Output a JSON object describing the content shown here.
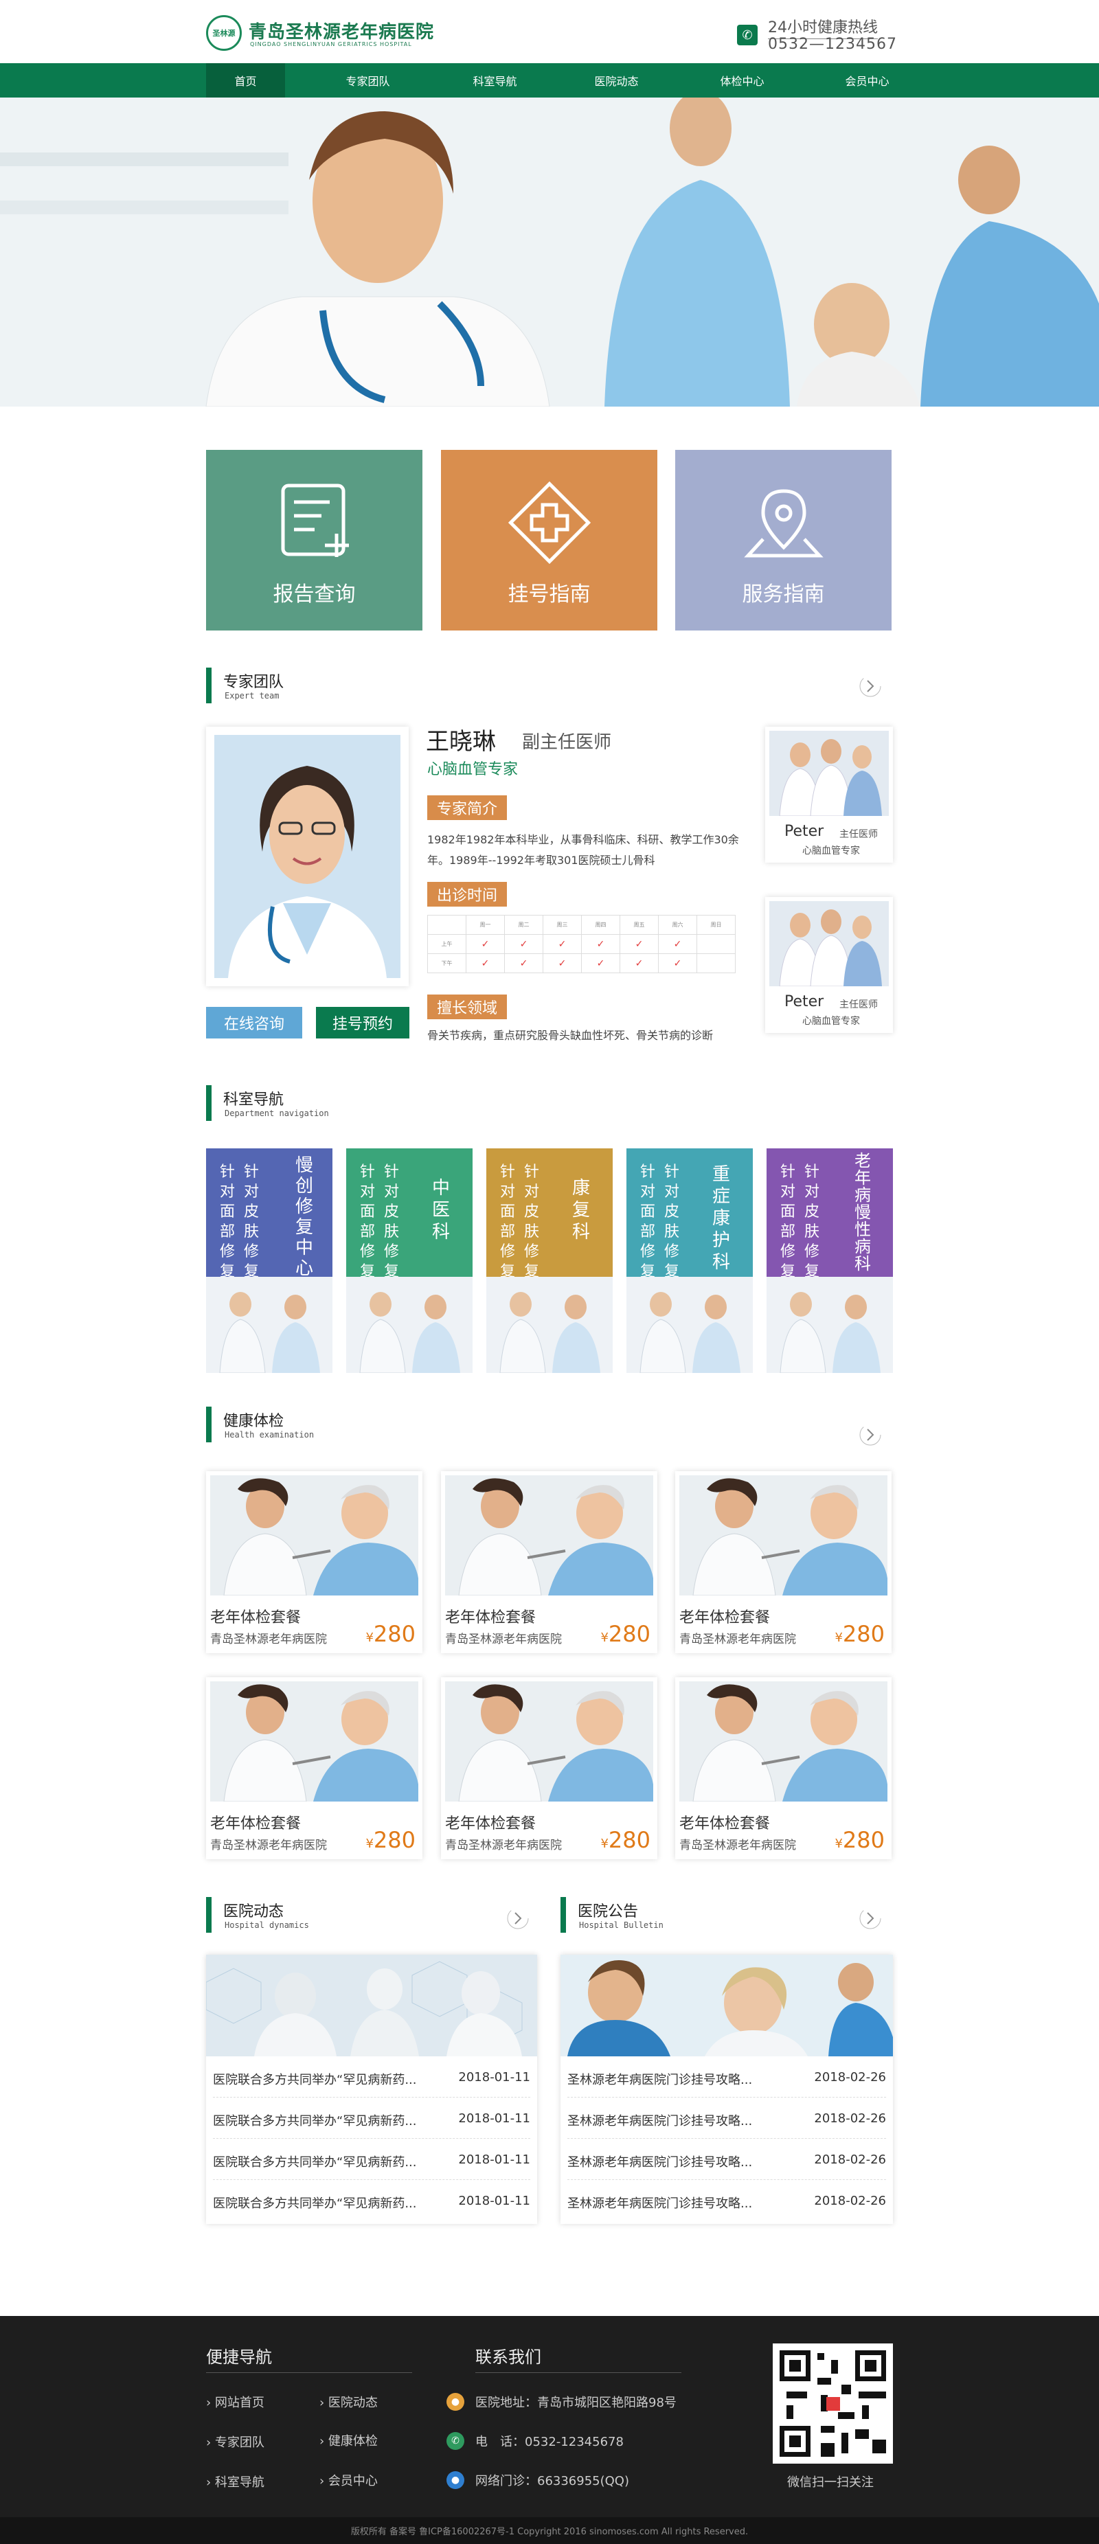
{
  "header": {
    "logo_mark": "圣林源",
    "title": "青岛圣林源老年病医院",
    "subtitle": "QINGDAO SHENGLINYUAN GERIATRICS HOSPITAL",
    "hotline_label": "24小时健康热线",
    "hotline_number": "0532—1234567"
  },
  "nav": {
    "items": [
      "首页",
      "专家团队",
      "科室导航",
      "医院动态",
      "体检中心",
      "会员中心"
    ],
    "active_index": 0
  },
  "quick": [
    {
      "label": "报告查询",
      "color": "#5a9c84",
      "icon": "report-icon"
    },
    {
      "label": "挂号指南",
      "color": "#d98e4e",
      "icon": "medical-cross-icon"
    },
    {
      "label": "服务指南",
      "color": "#a3adcf",
      "icon": "location-pin-icon"
    }
  ],
  "expert_section": {
    "title": "专家团队",
    "subtitle": "Expert team"
  },
  "expert": {
    "name": "王晓琳",
    "rank": "副主任医师",
    "specialty": "心脑血管专家",
    "intro_tag": "专家简介",
    "intro": "1982年1982年本科毕业，从事骨科临床、科研、教学工作30余年。1989年--1992年考取301医院硕士儿骨科",
    "schedule_tag": "出诊时间",
    "schedule_days": [
      "周一",
      "周二",
      "周三",
      "周四",
      "周五",
      "周六",
      "周日"
    ],
    "schedule_rows": [
      {
        "label": "上午",
        "marks": [
          "✓",
          "✓",
          "✓",
          "✓",
          "✓",
          "✓",
          ""
        ]
      },
      {
        "label": "下午",
        "marks": [
          "✓",
          "✓",
          "✓",
          "✓",
          "✓",
          "✓",
          ""
        ]
      }
    ],
    "field_tag": "擅长领域",
    "field": "骨关节疾病，重点研究股骨头缺血性坏死、骨关节病的诊断",
    "consult_btn": "在线咨询",
    "book_btn": "挂号预约"
  },
  "side_doctors": [
    {
      "name": "Peter",
      "rank": "主任医师",
      "specialty": "心脑血管专家"
    },
    {
      "name": "Peter",
      "rank": "主任医师",
      "specialty": "心脑血管专家"
    }
  ],
  "dept_section": {
    "title": "科室导航",
    "subtitle": "Department navigation"
  },
  "depts": [
    {
      "name": "慢创修复中心",
      "desc": [
        "针对面部修复",
        "针对皮肤修复"
      ],
      "color": "#5466b3"
    },
    {
      "name": "中医科",
      "desc": [
        "针对面部修复",
        "针对皮肤修复"
      ],
      "color": "#3aa57a"
    },
    {
      "name": "康复科",
      "desc": [
        "针对面部修复",
        "针对皮肤修复"
      ],
      "color": "#c99b3e"
    },
    {
      "name": "重症康护科",
      "desc": [
        "针对面部修复",
        "针对皮肤修复"
      ],
      "color": "#44a6b4"
    },
    {
      "name": "老年病慢性病科",
      "desc": [
        "针对面部修复",
        "针对皮肤修复"
      ],
      "color": "#8456b0"
    }
  ],
  "health_section": {
    "title": "健康体检",
    "subtitle": "Health examination"
  },
  "packages": [
    {
      "title": "老年体检套餐",
      "hospital": "青岛圣林源老年病医院",
      "currency": "¥",
      "price": "280"
    },
    {
      "title": "老年体检套餐",
      "hospital": "青岛圣林源老年病医院",
      "currency": "¥",
      "price": "280"
    },
    {
      "title": "老年体检套餐",
      "hospital": "青岛圣林源老年病医院",
      "currency": "¥",
      "price": "280"
    },
    {
      "title": "老年体检套餐",
      "hospital": "青岛圣林源老年病医院",
      "currency": "¥",
      "price": "280"
    },
    {
      "title": "老年体检套餐",
      "hospital": "青岛圣林源老年病医院",
      "currency": "¥",
      "price": "280"
    },
    {
      "title": "老年体检套餐",
      "hospital": "青岛圣林源老年病医院",
      "currency": "¥",
      "price": "280"
    }
  ],
  "dynamics": {
    "title": "医院动态",
    "subtitle": "Hospital dynamics",
    "items": [
      {
        "text": "医院联合多方共同举办“罕见病新药...",
        "date": "2018-01-11"
      },
      {
        "text": "医院联合多方共同举办“罕见病新药...",
        "date": "2018-01-11"
      },
      {
        "text": "医院联合多方共同举办“罕见病新药...",
        "date": "2018-01-11"
      },
      {
        "text": "医院联合多方共同举办“罕见病新药...",
        "date": "2018-01-11"
      }
    ]
  },
  "bulletin": {
    "title": "医院公告",
    "subtitle": "Hospital Bulletin",
    "items": [
      {
        "text": "圣林源老年病医院门诊挂号攻略...",
        "date": "2018-02-26"
      },
      {
        "text": "圣林源老年病医院门诊挂号攻略...",
        "date": "2018-02-26"
      },
      {
        "text": "圣林源老年病医院门诊挂号攻略...",
        "date": "2018-02-26"
      },
      {
        "text": "圣林源老年病医院门诊挂号攻略...",
        "date": "2018-02-26"
      }
    ]
  },
  "footer": {
    "quick_title": "便捷导航",
    "quick_links": [
      "网站首页",
      "医院动态",
      "专家团队",
      "健康体检",
      "科室导航",
      "会员中心"
    ],
    "contact_title": "联系我们",
    "address": "医院地址：青岛市城阳区艳阳路98号",
    "phone": "电　话：0532-12345678",
    "online": "网络门诊：66336955(QQ)",
    "qr_caption": "微信扫一扫关注",
    "copyright": "版权所有 备案号 鲁ICP备16002267号-1 Copyright 2016 sinomoses.com All rights Reserved."
  }
}
